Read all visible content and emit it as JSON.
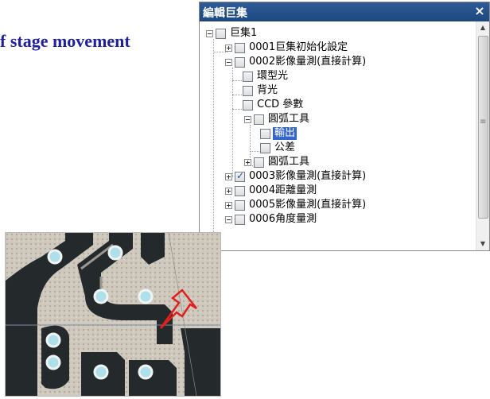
{
  "slide": {
    "heading": "f stage movement"
  },
  "window": {
    "title": "編輯巨集",
    "close_icon": "close-icon"
  },
  "tree": [
    {
      "label": "巨集1",
      "expander": "minus",
      "checked": false
    },
    {
      "label": "0001巨集初始化設定",
      "expander": "plus",
      "checked": false
    },
    {
      "label": "0002影像量測(直接計算)",
      "expander": "minus",
      "checked": false
    },
    {
      "label": "環型光",
      "expander": "none",
      "checked": false
    },
    {
      "label": "背光",
      "expander": "none",
      "checked": false
    },
    {
      "label": "CCD 參數",
      "expander": "none",
      "checked": false
    },
    {
      "label": "圓弧工具",
      "expander": "minus",
      "checked": false
    },
    {
      "label": "輸出",
      "expander": "none",
      "checked": false,
      "selected": true
    },
    {
      "label": "公差",
      "expander": "none",
      "checked": false
    },
    {
      "label": "圓弧工具",
      "expander": "plus",
      "checked": false
    },
    {
      "label": "0003影像量測(直接計算)",
      "expander": "plus",
      "checked": true
    },
    {
      "label": "0004距離量測",
      "expander": "plus",
      "checked": false
    },
    {
      "label": "0005影像量測(直接計算)",
      "expander": "plus",
      "checked": false
    },
    {
      "label": "0006角度量測",
      "expander": "minus",
      "checked": false
    }
  ],
  "colors": {
    "title_bar": "#1d477e",
    "selection": "#3366cc",
    "heading": "#1f1fa0",
    "camera_marker": "#e0201c"
  }
}
